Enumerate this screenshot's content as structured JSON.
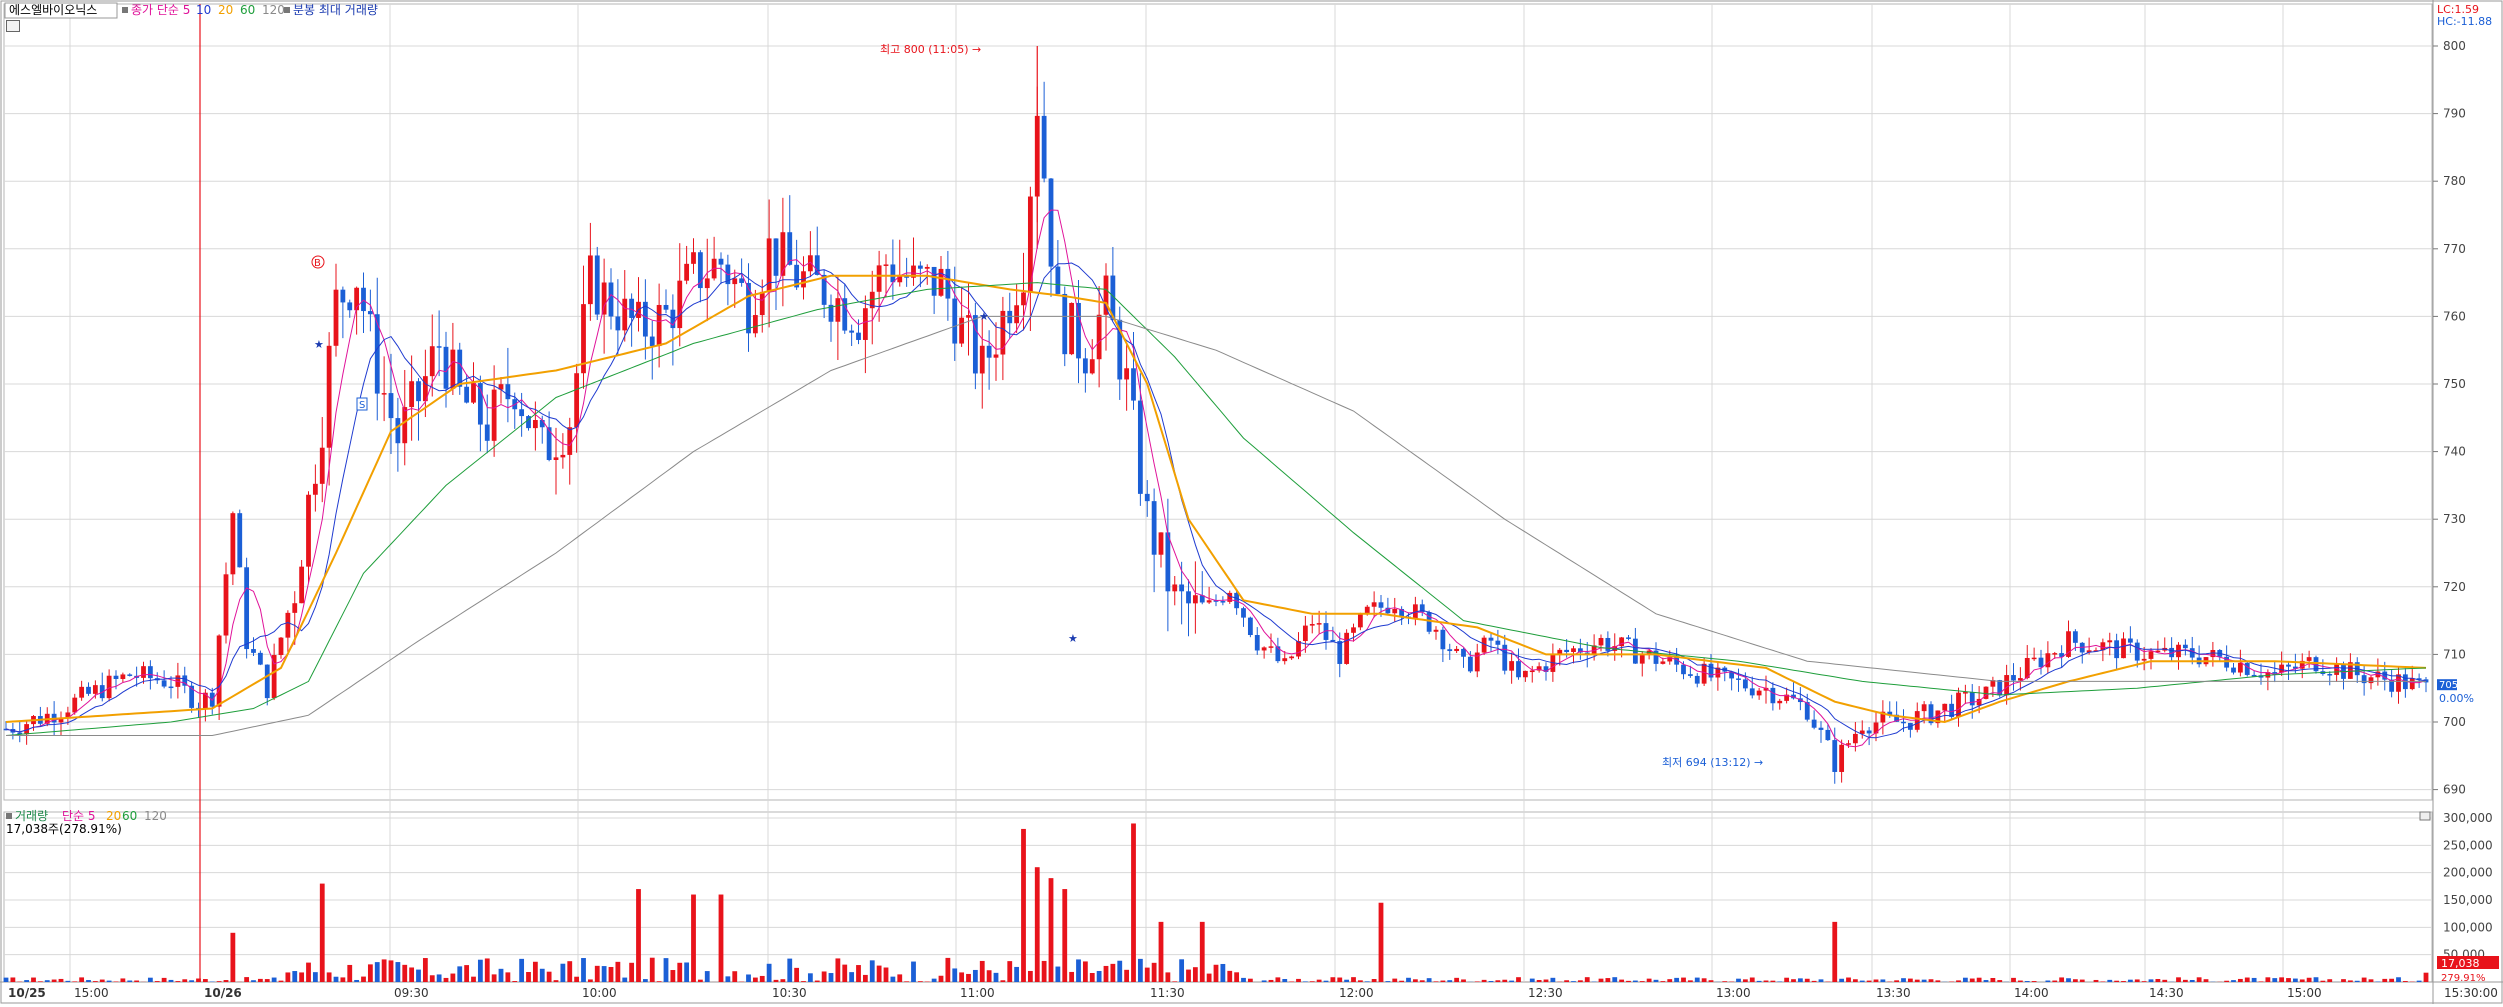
{
  "header": {
    "stock_name": "에스엘바이오닉스",
    "ma_label": "종가 단순",
    "ma_periods": [
      "5",
      "10",
      "20",
      "60",
      "120"
    ],
    "extra_label": "분봉 최대 거래량",
    "lc": "LC:1.59",
    "hc": "HC:-11.88"
  },
  "volume_header": {
    "label": "거래량",
    "ma_label": "단순",
    "ma_periods": [
      "5",
      "20",
      "60",
      "120"
    ],
    "current": "17,038주(278.91%)"
  },
  "markers": {
    "high": "최고 800 (11:05)",
    "low": "최저 694 (13:12)",
    "buy": "B",
    "sell": "S"
  },
  "price_badge": {
    "value": "705",
    "change": "0.00%"
  },
  "volume_badge": {
    "value": "17,038",
    "pct": "279.91%"
  },
  "colors": {
    "up": "#e8131b",
    "down": "#1b5fd6",
    "ma5": "#e0139a",
    "ma10": "#1f3bd0",
    "ma20": "#f2a000",
    "ma60": "#1e9e3b",
    "ma120": "#8a8a8a",
    "grid": "#d8d8d8"
  },
  "chart_data": {
    "type": "candlestick",
    "price_axis": {
      "range": [
        688,
        806
      ],
      "ticks": [
        690,
        700,
        710,
        720,
        730,
        740,
        750,
        760,
        770,
        780,
        790,
        800
      ]
    },
    "volume_axis": {
      "range": [
        0,
        300000
      ],
      "ticks": [
        "300,000",
        "250,000",
        "200,000",
        "150,000",
        "100,000",
        "50,000"
      ]
    },
    "time_labels": [
      "10/25",
      "15:00",
      "10/26",
      "09:30",
      "10:00",
      "10:30",
      "11:00",
      "11:30",
      "12:00",
      "12:30",
      "13:00",
      "13:30",
      "14:00",
      "14:30",
      "15:00",
      "15:30:00"
    ],
    "high": {
      "value": 800,
      "time": "11:05"
    },
    "low": {
      "value": 694,
      "time": "13:12"
    },
    "close_path": [
      [
        0,
        699
      ],
      [
        6,
        701
      ],
      [
        12,
        704
      ],
      [
        18,
        707
      ],
      [
        24,
        706
      ],
      [
        28,
        703
      ],
      [
        30,
        704
      ],
      [
        33,
        731
      ],
      [
        35,
        712
      ],
      [
        38,
        705
      ],
      [
        42,
        720
      ],
      [
        46,
        745
      ],
      [
        48,
        762
      ],
      [
        51,
        766
      ],
      [
        54,
        752
      ],
      [
        57,
        742
      ],
      [
        60,
        748
      ],
      [
        63,
        756
      ],
      [
        66,
        748
      ],
      [
        70,
        744
      ],
      [
        74,
        750
      ],
      [
        78,
        740
      ],
      [
        82,
        745
      ],
      [
        85,
        765
      ],
      [
        88,
        762
      ],
      [
        92,
        758
      ],
      [
        96,
        760
      ],
      [
        100,
        766
      ],
      [
        104,
        768
      ],
      [
        108,
        762
      ],
      [
        111,
        770
      ],
      [
        115,
        766
      ],
      [
        119,
        764
      ],
      [
        124,
        760
      ],
      [
        128,
        768
      ],
      [
        132,
        765
      ],
      [
        136,
        765
      ],
      [
        139,
        758
      ],
      [
        142,
        752
      ],
      [
        145,
        760
      ],
      [
        148,
        768
      ],
      [
        150,
        792
      ],
      [
        153,
        760
      ],
      [
        157,
        755
      ],
      [
        160,
        762
      ],
      [
        163,
        750
      ],
      [
        166,
        730
      ],
      [
        170,
        718
      ],
      [
        174,
        716
      ],
      [
        178,
        720
      ],
      [
        182,
        712
      ],
      [
        186,
        708
      ],
      [
        190,
        715
      ],
      [
        194,
        710
      ],
      [
        198,
        716
      ],
      [
        202,
        718
      ],
      [
        208,
        714
      ],
      [
        212,
        708
      ],
      [
        216,
        712
      ],
      [
        220,
        706
      ],
      [
        226,
        710
      ],
      [
        232,
        712
      ],
      [
        238,
        710
      ],
      [
        244,
        708
      ],
      [
        250,
        706
      ],
      [
        256,
        705
      ],
      [
        262,
        702
      ],
      [
        266,
        694
      ],
      [
        270,
        700
      ],
      [
        276,
        700
      ],
      [
        282,
        702
      ],
      [
        288,
        704
      ],
      [
        294,
        708
      ],
      [
        300,
        712
      ],
      [
        306,
        711
      ],
      [
        312,
        710
      ],
      [
        318,
        710
      ],
      [
        324,
        709
      ],
      [
        330,
        707
      ],
      [
        336,
        709
      ],
      [
        342,
        707
      ],
      [
        348,
        706
      ],
      [
        352,
        705
      ]
    ],
    "ma20_path": [
      [
        0,
        700
      ],
      [
        30,
        702
      ],
      [
        40,
        708
      ],
      [
        48,
        725
      ],
      [
        56,
        743
      ],
      [
        66,
        750
      ],
      [
        80,
        752
      ],
      [
        96,
        756
      ],
      [
        108,
        763
      ],
      [
        120,
        766
      ],
      [
        134,
        766
      ],
      [
        146,
        764
      ],
      [
        154,
        763
      ],
      [
        160,
        762
      ],
      [
        166,
        750
      ],
      [
        172,
        730
      ],
      [
        180,
        718
      ],
      [
        190,
        716
      ],
      [
        200,
        716
      ],
      [
        214,
        714
      ],
      [
        224,
        710
      ],
      [
        240,
        710
      ],
      [
        256,
        708
      ],
      [
        266,
        703
      ],
      [
        274,
        701
      ],
      [
        282,
        700
      ],
      [
        290,
        703
      ],
      [
        300,
        706
      ],
      [
        312,
        709
      ],
      [
        330,
        709
      ],
      [
        352,
        708
      ]
    ],
    "ma60_path": [
      [
        0,
        698
      ],
      [
        24,
        700
      ],
      [
        36,
        702
      ],
      [
        44,
        706
      ],
      [
        52,
        722
      ],
      [
        64,
        735
      ],
      [
        80,
        748
      ],
      [
        100,
        756
      ],
      [
        118,
        761
      ],
      [
        134,
        764
      ],
      [
        150,
        765
      ],
      [
        160,
        764
      ],
      [
        170,
        754
      ],
      [
        180,
        742
      ],
      [
        196,
        728
      ],
      [
        212,
        715
      ],
      [
        232,
        711
      ],
      [
        252,
        709
      ],
      [
        270,
        706
      ],
      [
        290,
        704
      ],
      [
        310,
        705
      ],
      [
        330,
        707
      ],
      [
        352,
        708
      ]
    ],
    "ma120_path": [
      [
        0,
        698
      ],
      [
        30,
        698
      ],
      [
        44,
        701
      ],
      [
        60,
        712
      ],
      [
        80,
        725
      ],
      [
        100,
        740
      ],
      [
        120,
        752
      ],
      [
        142,
        760
      ],
      [
        160,
        760
      ],
      [
        176,
        755
      ],
      [
        196,
        746
      ],
      [
        218,
        730
      ],
      [
        240,
        716
      ],
      [
        262,
        709
      ],
      [
        290,
        706
      ],
      [
        320,
        706
      ],
      [
        352,
        706
      ]
    ],
    "volume_spikes": [
      [
        33,
        90000
      ],
      [
        46,
        180000
      ],
      [
        92,
        170000
      ],
      [
        100,
        160000
      ],
      [
        104,
        160000
      ],
      [
        148,
        280000
      ],
      [
        150,
        210000
      ],
      [
        152,
        190000
      ],
      [
        154,
        170000
      ],
      [
        164,
        290000
      ],
      [
        168,
        110000
      ],
      [
        174,
        110000
      ],
      [
        200,
        145000
      ],
      [
        266,
        110000
      ],
      [
        352,
        17038
      ]
    ]
  }
}
